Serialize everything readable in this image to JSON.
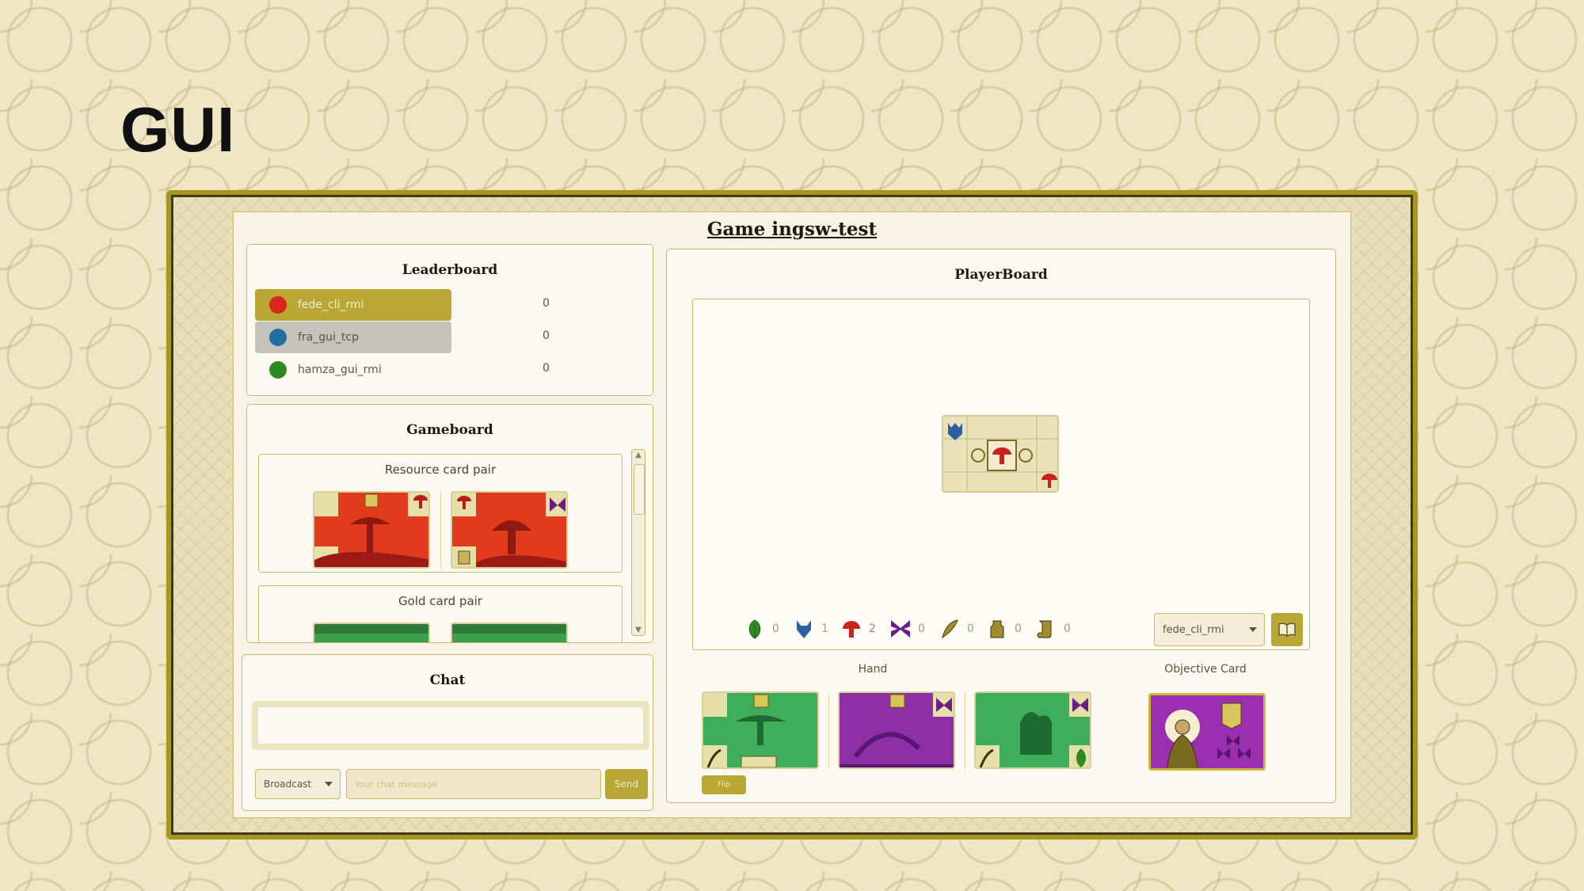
{
  "slide": {
    "title": "GUI"
  },
  "window": {
    "title": "Game  ingsw-test"
  },
  "leaderboard": {
    "title": "Leaderboard",
    "players": [
      {
        "name": "fede_cli_rmi",
        "score": "0",
        "token_color": "#d8271c",
        "highlight": "#b8a635"
      },
      {
        "name": "fra_gui_tcp",
        "score": "0",
        "token_color": "#1f6fa3",
        "highlight": "#c4c2bb"
      },
      {
        "name": "hamza_gui_rmi",
        "score": "0",
        "token_color": "#2f8a22",
        "highlight": ""
      }
    ]
  },
  "gameboard": {
    "title": "Gameboard",
    "groups": [
      {
        "label": "Resource card pair",
        "cards": [
          "mushroom-card",
          "mushroom-card"
        ]
      },
      {
        "label": "Gold card pair",
        "cards": [
          "plant-card",
          "plant-card"
        ]
      }
    ]
  },
  "chat": {
    "title": "Chat",
    "recipient": "Broadcast",
    "placeholder": "Your chat message",
    "send_label": "Send"
  },
  "player_board": {
    "title": "PlayerBoard",
    "resources": [
      {
        "icon": "leaf-icon",
        "count": "0",
        "color": "#2f8a22"
      },
      {
        "icon": "wolf-icon",
        "count": "1",
        "color": "#2a5fa3"
      },
      {
        "icon": "mushroom-icon",
        "count": "2",
        "color": "#c8231c"
      },
      {
        "icon": "butterfly-icon",
        "count": "0",
        "color": "#6b1f86"
      },
      {
        "icon": "quill-icon",
        "count": "0",
        "color": "#a08c2a"
      },
      {
        "icon": "inkwell-icon",
        "count": "0",
        "color": "#a08c2a"
      },
      {
        "icon": "scroll-icon",
        "count": "0",
        "color": "#a08c2a"
      }
    ],
    "selected_player": "fede_cli_rmi",
    "hand_label": "Hand",
    "objective_label": "Objective Card",
    "flip_label": "Flip"
  }
}
